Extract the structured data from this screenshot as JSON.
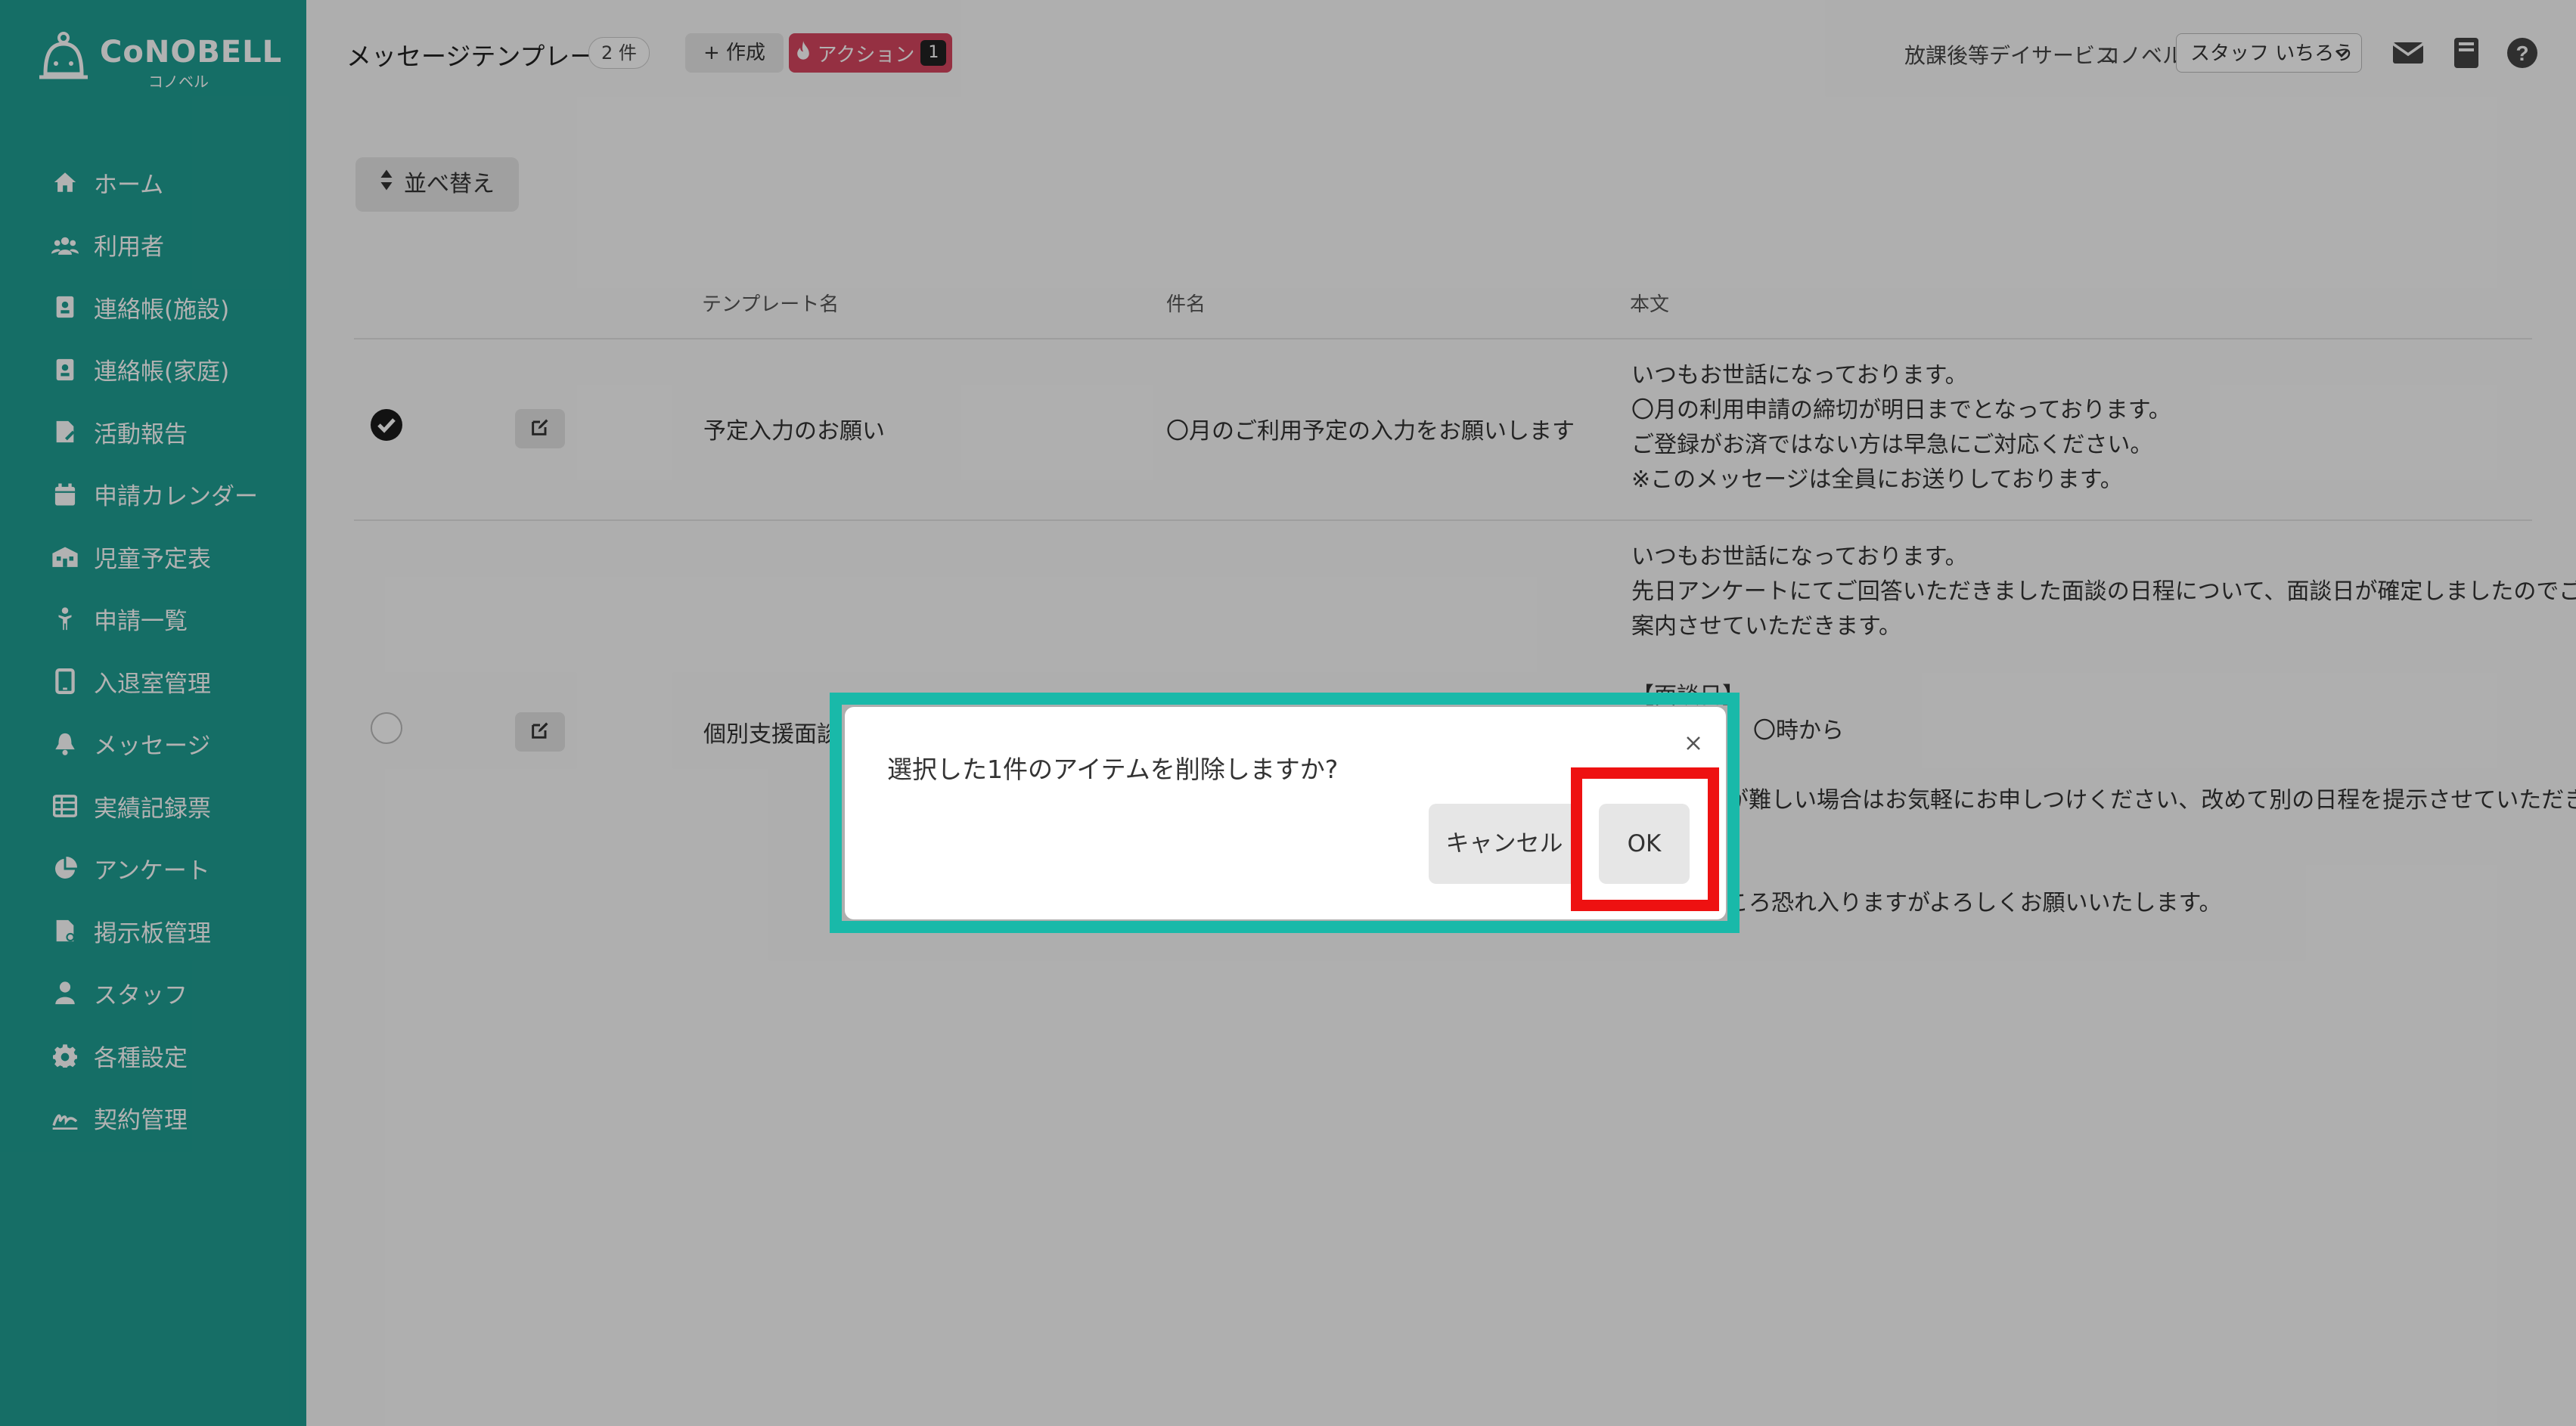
{
  "brand": {
    "name": "CoNOBELL",
    "sub": "コノベル"
  },
  "sidebar": {
    "items": [
      {
        "label": "ホーム",
        "icon": "home-icon"
      },
      {
        "label": "利用者",
        "icon": "users-icon"
      },
      {
        "label": "連絡帳(施設)",
        "icon": "contact-book-icon"
      },
      {
        "label": "連絡帳(家庭)",
        "icon": "contact-book-icon"
      },
      {
        "label": "活動報告",
        "icon": "report-icon"
      },
      {
        "label": "申請カレンダー",
        "icon": "calendar-icon"
      },
      {
        "label": "児童予定表",
        "icon": "schedule-icon"
      },
      {
        "label": "申請一覧",
        "icon": "child-icon"
      },
      {
        "label": "入退室管理",
        "icon": "tablet-icon"
      },
      {
        "label": "メッセージ",
        "icon": "bell-icon"
      },
      {
        "label": "実績記録票",
        "icon": "table-icon"
      },
      {
        "label": "アンケート",
        "icon": "pie-chart-icon"
      },
      {
        "label": "掲示板管理",
        "icon": "board-icon"
      },
      {
        "label": "スタッフ",
        "icon": "staff-icon"
      },
      {
        "label": "各種設定",
        "icon": "gear-icon"
      },
      {
        "label": "契約管理",
        "icon": "signature-icon"
      }
    ]
  },
  "header": {
    "title": "メッセージテンプレート",
    "count": "2 件",
    "create_label": "+ 作成",
    "action_label": "アクション",
    "action_count": "1",
    "facility": "放課後等デイサービス",
    "org": "コノベル",
    "staff": "スタッフ いちろう"
  },
  "toolbar": {
    "sort_label": "並べ替え"
  },
  "table": {
    "columns": [
      "テンプレート名",
      "件名",
      "本文"
    ],
    "rows": [
      {
        "checked": true,
        "name": "予定入力のお願い",
        "subject": "〇月のご利用予定の入力をお願いします",
        "body": "いつもお世話になっております。\n〇月の利用申請の締切が明日までとなっております。\nご登録がお済ではない方は早急にご対応ください。\n※このメッセージは全員にお送りしております。"
      },
      {
        "checked": false,
        "name": "個別支援面談",
        "subject": "",
        "body_visible": [
          "いつもお世話になっております。",
          "先日アンケートにてご回答いただきました面談の日程について、面談日が確定しましたのでご",
          "案内させていただきます。",
          "【面談日】",
          "〇時から",
          "が難しい場合はお気軽にお申しつけください、改めて別の日程を提示させていただき",
          "ころ恐れ入りますがよろしくお願いいたします。"
        ]
      }
    ]
  },
  "dialog": {
    "message": "選択した1件のアイテムを削除しますか?",
    "cancel_label": "キャンセル",
    "ok_label": "OK"
  },
  "colors": {
    "sidebar": "#1f9e92",
    "action": "#d6455f",
    "highlight_frame": "#19b9a9",
    "highlight_target": "#ee1111"
  }
}
